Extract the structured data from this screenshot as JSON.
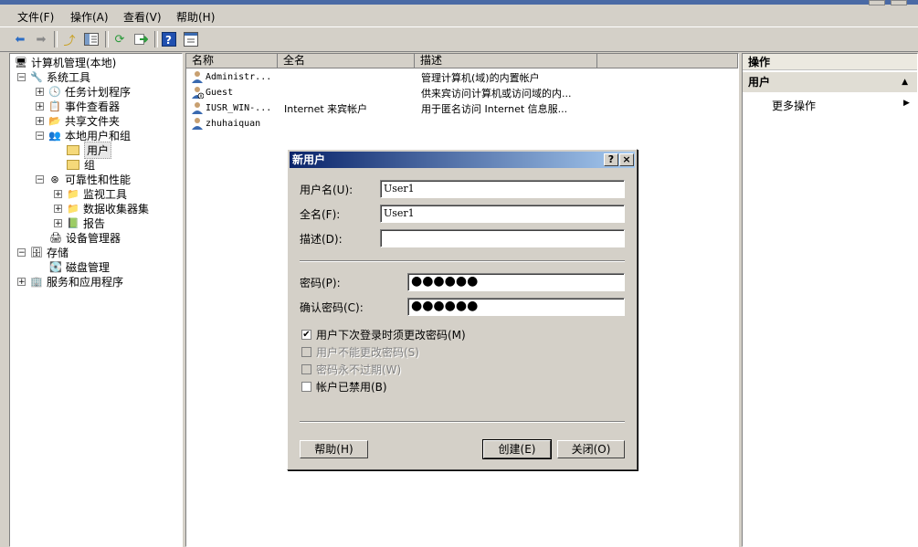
{
  "menu": [
    "文件(F)",
    "操作(A)",
    "查看(V)",
    "帮助(H)"
  ],
  "toolbar": {
    "icons": [
      "back-icon",
      "forward-icon",
      "up-icon",
      "show-hide-tree-icon",
      "refresh-icon",
      "export-icon",
      "help-icon",
      "properties-icon"
    ]
  },
  "tree": {
    "root": "计算机管理(本地)",
    "system_tools": "系统工具",
    "task_scheduler": "任务计划程序",
    "event_viewer": "事件查看器",
    "shared_folders": "共享文件夹",
    "local_users_groups": "本地用户和组",
    "users": "用户",
    "groups": "组",
    "reliability": "可靠性和性能",
    "monitoring_tools": "监视工具",
    "data_collector": "数据收集器集",
    "reports": "报告",
    "device_manager": "设备管理器",
    "storage": "存储",
    "disk_management": "磁盘管理",
    "services_apps": "服务和应用程序"
  },
  "list": {
    "columns": [
      "名称",
      "全名",
      "描述"
    ],
    "rows": [
      {
        "name": "Administr...",
        "fullname": "",
        "desc": "管理计算机(域)的内置帐户"
      },
      {
        "name": "Guest",
        "fullname": "",
        "desc": "供来宾访问计算机或访问域的内..."
      },
      {
        "name": "IUSR_WIN-...",
        "fullname": "Internet 来宾帐户",
        "desc": "用于匿名访问 Internet 信息服..."
      },
      {
        "name": "zhuhaiquan",
        "fullname": "",
        "desc": ""
      }
    ]
  },
  "actions": {
    "header": "操作",
    "section": "用户",
    "more": "更多操作"
  },
  "dialog": {
    "title": "新用户",
    "help_glyph": "?",
    "close_glyph": "×",
    "username_label": "用户名(U):",
    "username_value": "User1",
    "fullname_label": "全名(F):",
    "fullname_value": "User1",
    "desc_label": "描述(D):",
    "desc_value": "",
    "password_label": "密码(P):",
    "password_value": "●●●●●●",
    "confirm_label": "确认密码(C):",
    "confirm_value": "●●●●●●",
    "cb_must_change": "用户下次登录时须更改密码(M)",
    "cb_cannot_change": "用户不能更改密码(S)",
    "cb_never_expires": "密码永不过期(W)",
    "cb_disabled": "帐户已禁用(B)",
    "must_change_checked": true,
    "btn_help": "帮助(H)",
    "btn_create": "创建(E)",
    "btn_close": "关闭(O)"
  },
  "colors": {
    "title_start": "#0a246a",
    "title_end": "#a6caf0",
    "window_bg": "#d4d0c8"
  }
}
